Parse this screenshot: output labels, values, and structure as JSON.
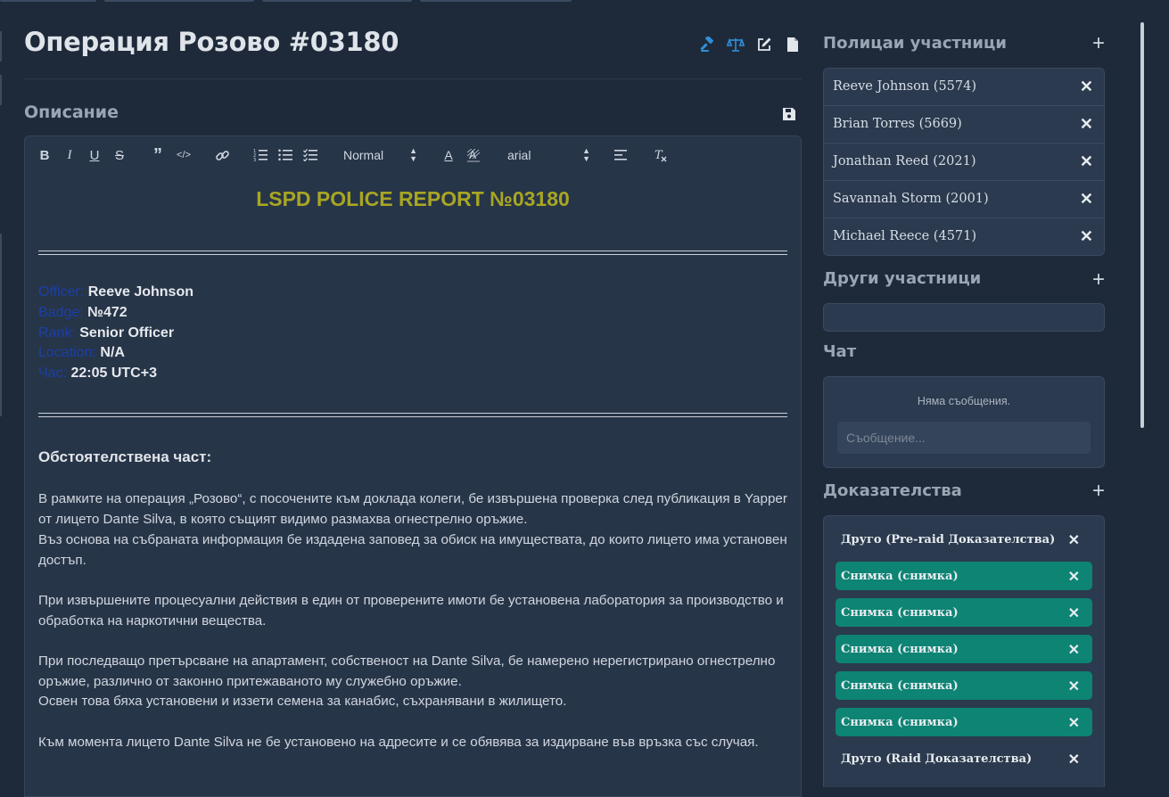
{
  "title": "Операция Розово #03180",
  "description_label": "Описание",
  "editor": {
    "toolbar": {
      "header_select": "Normal",
      "font_select": "arial"
    },
    "report_heading": "LSPD POLICE REPORT №03180",
    "fields": [
      {
        "key": "Officer:",
        "value": "Reeve Johnson"
      },
      {
        "key": "Badge:",
        "value": "№472"
      },
      {
        "key": "Rank:",
        "value": "Senior Officer"
      },
      {
        "key": "Location:",
        "value": "N/A"
      },
      {
        "key": "Час:",
        "value": "22:05 UTC+3"
      }
    ],
    "sub_heading": "Обстоятелствена част:",
    "paragraphs": [
      "В рамките на операция „Розово“, с посочените към доклада колеги, бе извършена проверка след публикация в Yapper от лицето Dante Silva, в която същият видимо размахва огнестрелно оръжие.",
      "Въз основа на събраната информация бе издадена заповед за обиск на имуществата, до които лицето има установен достъп.",
      "При извършените процесуални действия в един от проверените имоти бе установена лаборатория за производство и обработка на наркотични вещества.",
      "При последващо претърсване на апартамент, собственост на Dante Silva, бе намерено нерегистрирано огнестрелно оръжие, различно от законно притежаваното му служебно оръжие.",
      "Освен това бяха установени и иззети семена за канабис, съхранявани в жилището.",
      "Към момента лицето Dante Silva не бе установено на адресите и се обявява за издирване във връзка със случая."
    ]
  },
  "sidebar": {
    "officers_label": "Полицаи участници",
    "officers": [
      "Reeve Johnson (5574)",
      "Brian Torres (5669)",
      "Jonathan Reed (2021)",
      "Savannah Storm (2001)",
      "Michael Reece (4571)"
    ],
    "others_label": "Други участници",
    "chat_label": "Чат",
    "chat_empty": "Няма съобщения.",
    "chat_placeholder": "Съобщение...",
    "evidence_label": "Доказателства",
    "evidence": [
      {
        "label": "Друго (Pre-raid Доказателства)",
        "style": "plain"
      },
      {
        "label": "Снимка (снимка)",
        "style": "green"
      },
      {
        "label": "Снимка (снимка)",
        "style": "green"
      },
      {
        "label": "Снимка (снимка)",
        "style": "green"
      },
      {
        "label": "Снимка (снимка)",
        "style": "green"
      },
      {
        "label": "Снимка (снимка)",
        "style": "green"
      },
      {
        "label": "Друго (Raid Доказателства)",
        "style": "plain"
      }
    ]
  },
  "icons": {
    "gavel": "gavel-icon",
    "scales": "scales-icon",
    "edit": "edit-icon",
    "file": "file-icon",
    "save": "save-icon",
    "plus": "plus-icon",
    "close": "close-icon"
  },
  "colors": {
    "accent_blue": "#2f8fd8",
    "heading_olive": "#a8a623",
    "field_key_blue": "#1a3fa8",
    "evidence_green": "#0d8474",
    "background": "#1e2a3a"
  }
}
